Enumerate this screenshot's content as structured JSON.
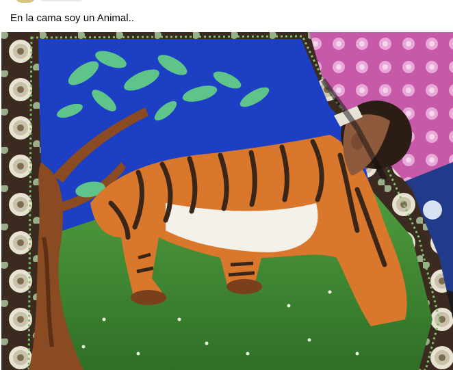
{
  "post": {
    "caption": "En la cama soy un Animal.."
  },
  "image": {
    "subject": "photo",
    "colors": {
      "sky": "#1c3fc4",
      "ground": "#3f8f35",
      "tiger": "#d9772c",
      "border": "#3b2a20",
      "pillow": "#c65aa8"
    }
  }
}
